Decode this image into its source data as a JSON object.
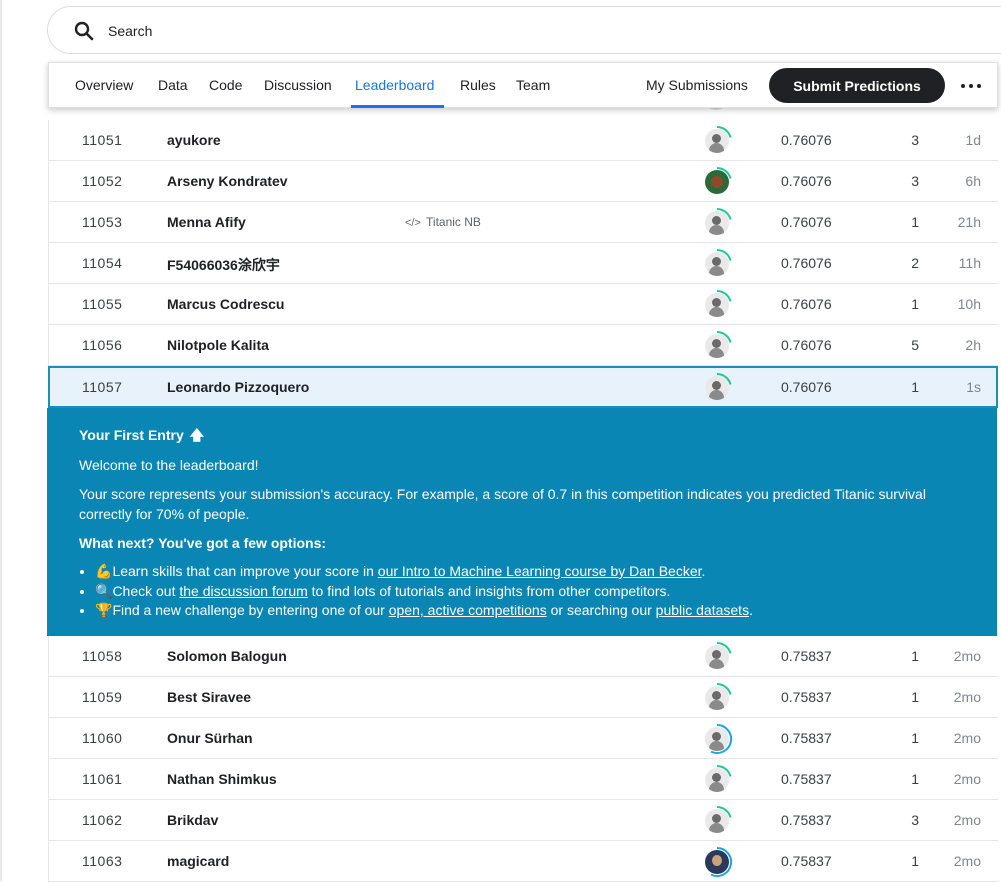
{
  "search": {
    "placeholder": "Search"
  },
  "tabs": [
    {
      "label": "Overview"
    },
    {
      "label": "Data"
    },
    {
      "label": "Code"
    },
    {
      "label": "Discussion"
    },
    {
      "label": "Leaderboard",
      "active": true
    },
    {
      "label": "Rules"
    },
    {
      "label": "Team"
    }
  ],
  "header": {
    "my_submissions": "My Submissions",
    "submit_label": "Submit Predictions"
  },
  "rows_top": [
    {
      "rank": "11051",
      "name": "ayukore",
      "avatar": "default-avatar",
      "score": "0.76076",
      "entries": "3",
      "last": "1d"
    },
    {
      "rank": "11052",
      "name": "Arseny Kondratev",
      "avatar": "custom-avatar",
      "score": "0.76076",
      "entries": "3",
      "last": "6h"
    },
    {
      "rank": "11053",
      "name": "Menna Afify",
      "notebook": "Titanic NB",
      "avatar": "default-avatar",
      "score": "0.76076",
      "entries": "1",
      "last": "21h"
    },
    {
      "rank": "11054",
      "name": "F54066036涂欣宇",
      "avatar": "default-avatar",
      "score": "0.76076",
      "entries": "2",
      "last": "11h"
    },
    {
      "rank": "11055",
      "name": "Marcus Codrescu",
      "avatar": "default-avatar",
      "score": "0.76076",
      "entries": "1",
      "last": "10h"
    },
    {
      "rank": "11056",
      "name": "Nilotpole Kalita",
      "avatar": "default-avatar",
      "score": "0.76076",
      "entries": "5",
      "last": "2h"
    }
  ],
  "current_row": {
    "rank": "11057",
    "name": "Leonardo Pizzoquero",
    "avatar": "default-avatar",
    "score": "0.76076",
    "entries": "1",
    "last": "1s"
  },
  "info": {
    "title": "Your First Entry",
    "arrow_icon": "arrow-up-icon",
    "welcome": "Welcome to the leaderboard!",
    "score_text": "Your score represents your submission's accuracy. For example, a score of 0.7 in this competition indicates you predicted Titanic survival correctly for 70% of people.",
    "next": "What next? You've got a few options:",
    "opt1": {
      "emoji": "💪",
      "pre": "Learn skills that can improve your score in ",
      "link": "our Intro to Machine Learning course by Dan Becker",
      "post": "."
    },
    "opt2": {
      "emoji": "🔍",
      "pre": "Check out ",
      "link": "the discussion forum",
      "post": " to find lots of tutorials and insights from other competitors."
    },
    "opt3": {
      "emoji": "🏆",
      "pre": "Find a new challenge by entering one of our ",
      "link": "open, active competitions",
      "mid": " or searching our ",
      "link2": "public datasets",
      "post": "."
    }
  },
  "rows_bottom": [
    {
      "rank": "11058",
      "name": "Solomon Balogun",
      "avatar": "default-avatar",
      "score": "0.75837",
      "entries": "1",
      "last": "2mo"
    },
    {
      "rank": "11059",
      "name": "Best Siravee",
      "avatar": "default-avatar",
      "score": "0.75837",
      "entries": "1",
      "last": "2mo"
    },
    {
      "rank": "11060",
      "name": "Onur Sürhan",
      "avatar": "default-avatar",
      "score": "0.75837",
      "entries": "1",
      "last": "2mo"
    },
    {
      "rank": "11061",
      "name": "Nathan Shimkus",
      "avatar": "default-avatar",
      "score": "0.75837",
      "entries": "1",
      "last": "2mo"
    },
    {
      "rank": "11062",
      "name": "Brikdav",
      "avatar": "default-avatar",
      "score": "0.75837",
      "entries": "3",
      "last": "2mo"
    },
    {
      "rank": "11063",
      "name": "magicard",
      "avatar": "photo-avatar",
      "score": "0.75837",
      "entries": "1",
      "last": "2mo"
    }
  ],
  "colors": {
    "accent": "#1a73e8",
    "banner": "#0a86b5",
    "highlight_row": "#e8f2fb",
    "ring_green": "#20beff",
    "ring_blue": "#1aa3e8"
  }
}
